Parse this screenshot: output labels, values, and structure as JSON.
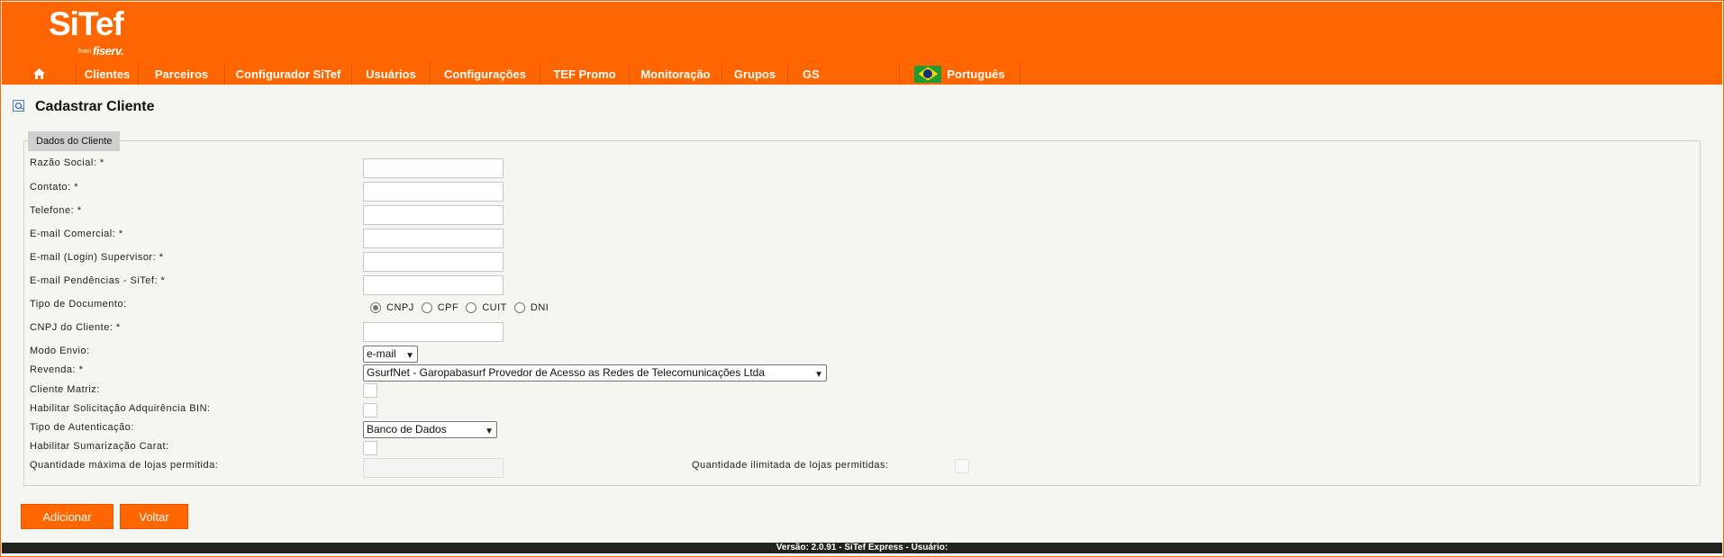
{
  "brand": {
    "logo": "SiTef",
    "from": "from",
    "company": "fiserv."
  },
  "nav": {
    "items": [
      "Clientes",
      "Parceiros",
      "Configurador SiTef",
      "Usuários",
      "Configurações",
      "TEF Promo",
      "Monitoração",
      "Grupos",
      "GS"
    ],
    "language": "Português"
  },
  "page": {
    "title": "Cadastrar Cliente"
  },
  "form": {
    "legend": "Dados do Cliente",
    "labels": {
      "razao_social": "Razão Social:  *",
      "contato": "Contato:  *",
      "telefone": "Telefone:  *",
      "email_comercial": "E-mail Comercial:  *",
      "email_supervisor": "E-mail (Login) Supervisor:  *",
      "email_pendencias": "E-mail Pendências - SiTef:  *",
      "tipo_documento": "Tipo de Documento:",
      "cnpj_cliente": "CNPJ do Cliente: *",
      "modo_envio": "Modo Envio:",
      "revenda": "Revenda:  *",
      "cliente_matriz": "Cliente Matriz:",
      "habilitar_bin": "Habilitar Solicitação Adquirência BIN:",
      "tipo_autenticacao": "Tipo de Autenticação:",
      "habilitar_carat": "Habilitar Sumarização Carat:",
      "qtd_max_lojas": "Quantidade máxima de lojas permitida:",
      "qtd_ilimitada_lojas": "Quantidade ilimitada de lojas permitidas:"
    },
    "document_types": [
      "CNPJ",
      "CPF",
      "CUIT",
      "DNI"
    ],
    "selected_document": "CNPJ",
    "modo_envio_value": "e-mail",
    "revenda_value": "GsurfNet - Garopabasurf Provedor de Acesso as Redes de Telecomunicações Ltda",
    "autenticacao_value": "Banco de Dados"
  },
  "buttons": {
    "add": "Adicionar",
    "back": "Voltar"
  },
  "footer": {
    "version": "Versão: 2.0.91 - SiTef Express - Usuário:"
  },
  "colors": {
    "brand": "#ff6600",
    "footer": "#222222"
  }
}
